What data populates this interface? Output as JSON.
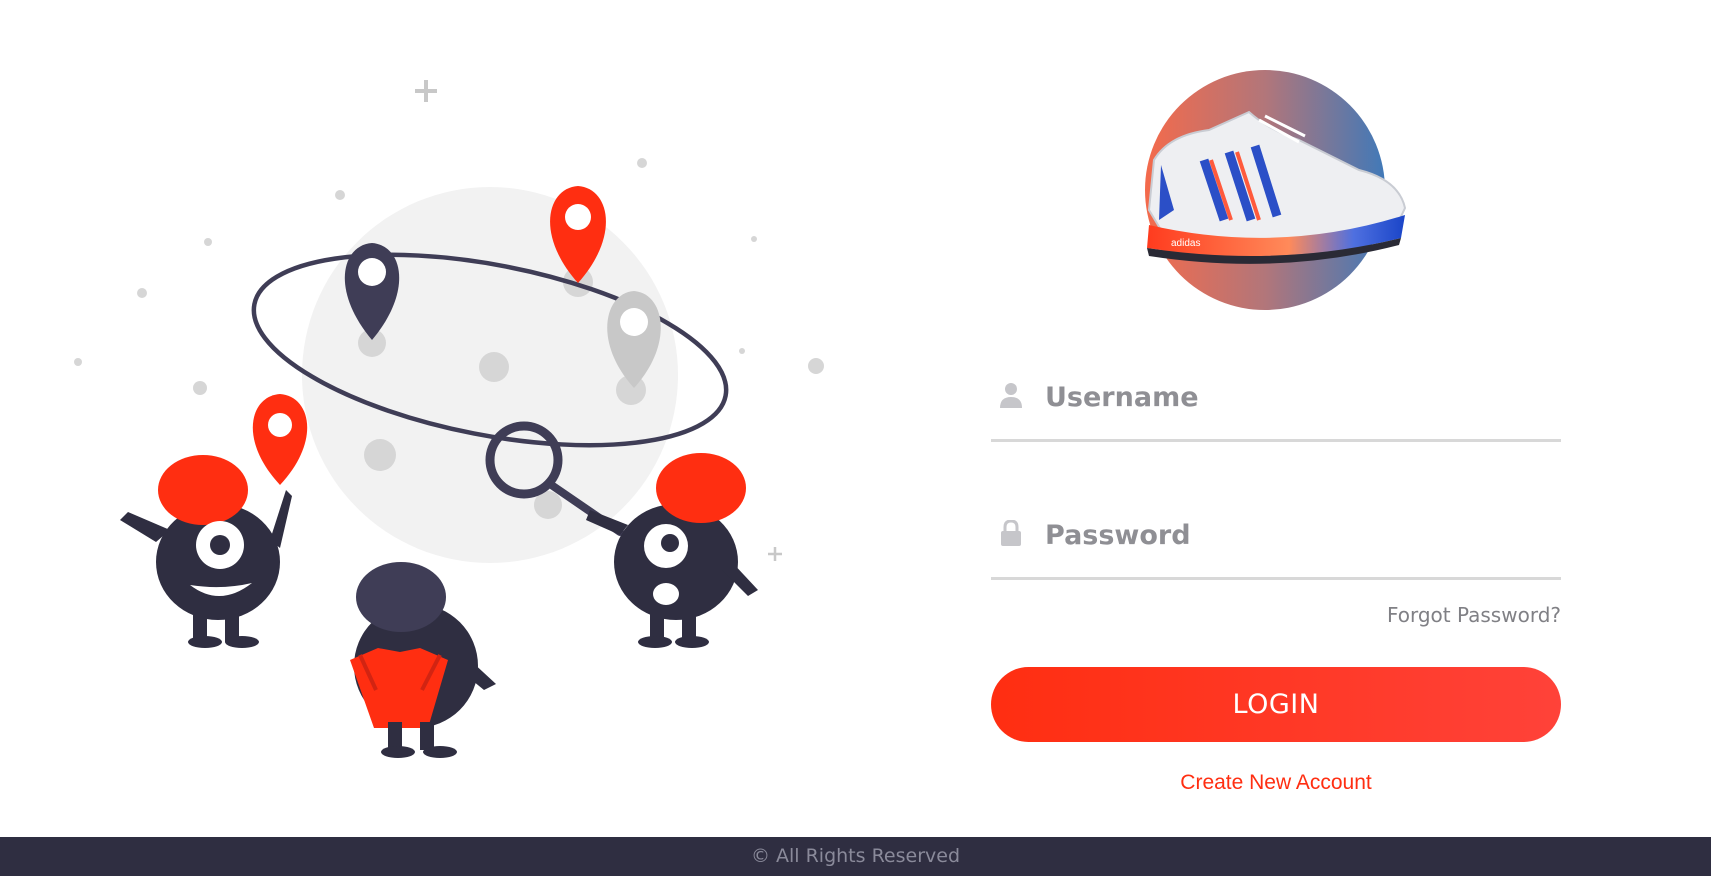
{
  "form": {
    "username_placeholder": "Username",
    "password_placeholder": "Password",
    "forgot_label": "Forgot Password?",
    "login_label": "LOGIN",
    "create_label": "Create New Account"
  },
  "footer": {
    "text": "© All Rights Reserved"
  },
  "logo": {
    "brand_text": "adidas"
  },
  "icons": {
    "username": "user-icon",
    "password": "lock-icon"
  },
  "colors": {
    "accent": "#ff2e11",
    "dark": "#2f2e41",
    "field_border": "#d8d8d8",
    "placeholder": "#8f8f94"
  }
}
